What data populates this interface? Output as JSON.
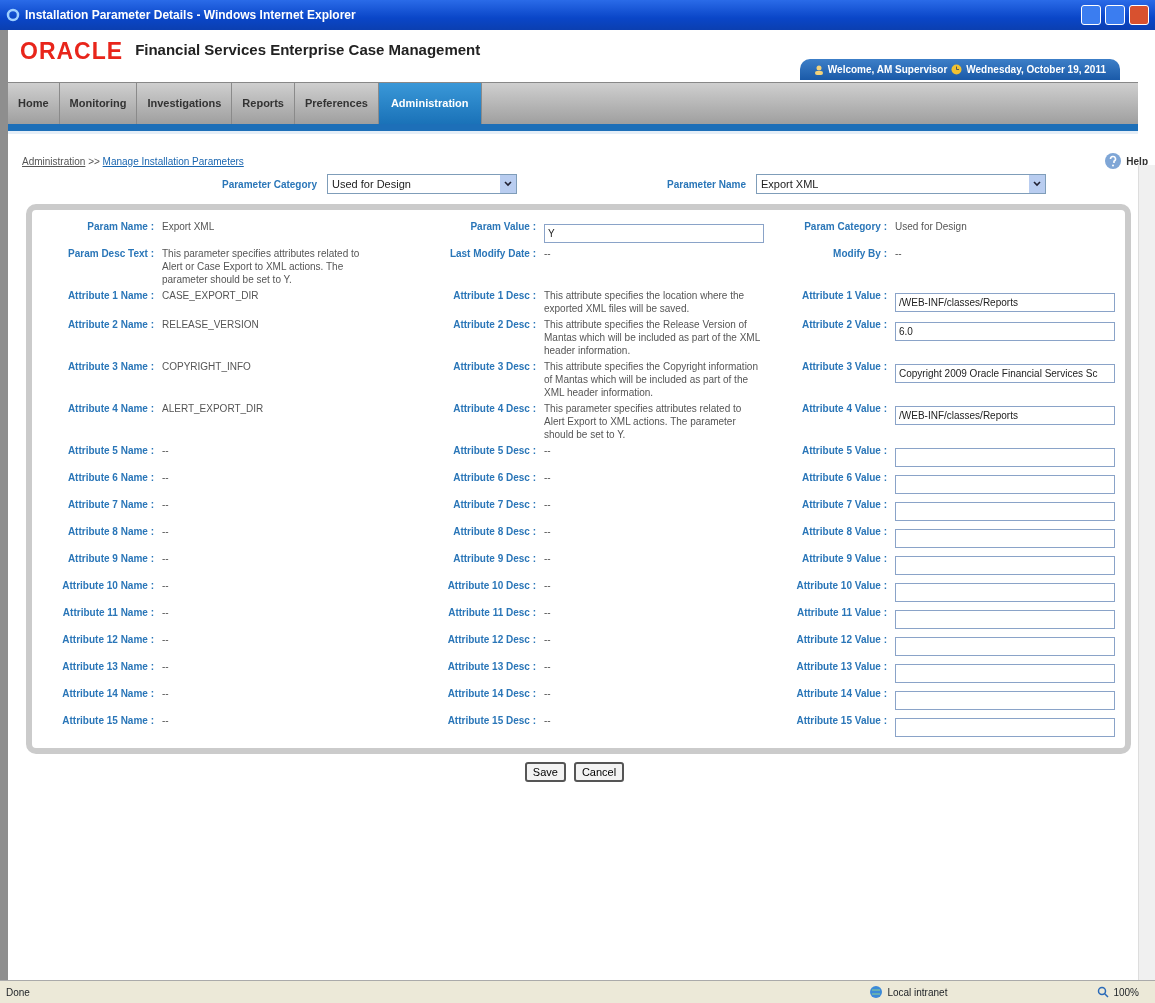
{
  "window": {
    "title": "Installation Parameter Details - Windows Internet Explorer"
  },
  "header": {
    "logo": "ORACLE",
    "app_title": "Financial Services Enterprise Case Management",
    "welcome": "Welcome, AM Supervisor",
    "date": "Wednesday, October 19, 2011"
  },
  "tabs": [
    {
      "label": "Home",
      "selected": false
    },
    {
      "label": "Monitoring",
      "selected": false
    },
    {
      "label": "Investigations",
      "selected": false
    },
    {
      "label": "Reports",
      "selected": false
    },
    {
      "label": "Preferences",
      "selected": false
    },
    {
      "label": "Administration",
      "selected": true
    }
  ],
  "breadcrumb": {
    "items": [
      "Administration",
      "Manage Installation Parameters"
    ],
    "separator": ">>"
  },
  "help": "Help",
  "filters": [
    {
      "label": "Parameter Category",
      "value": "Used for Design"
    },
    {
      "label": "Parameter Name",
      "value": "Export XML"
    }
  ],
  "rows": [
    [
      {
        "label": "Param Name :",
        "kind": "text",
        "value": "Export XML"
      },
      {
        "label": "Param Value :",
        "kind": "input",
        "value": "Y"
      },
      {
        "label": "Param Category :",
        "kind": "text",
        "value": "Used for Design"
      }
    ],
    [
      {
        "label": "Param Desc Text :",
        "kind": "text",
        "value": "This parameter specifies attributes related to Alert or Case Export to XML actions. The parameter should be set to Y."
      },
      {
        "label": "Last Modify Date :",
        "kind": "text",
        "value": "--"
      },
      {
        "label": "Modify By :",
        "kind": "text",
        "value": "--"
      }
    ],
    [
      {
        "label": "Attribute 1 Name :",
        "kind": "text",
        "value": "CASE_EXPORT_DIR"
      },
      {
        "label": "Attribute 1 Desc :",
        "kind": "text",
        "value": "This attribute specifies the location where the exported XML files will be saved."
      },
      {
        "label": "Attribute 1 Value :",
        "kind": "input",
        "value": "/WEB-INF/classes/Reports"
      }
    ],
    [
      {
        "label": "Attribute 2 Name :",
        "kind": "text",
        "value": "RELEASE_VERSION"
      },
      {
        "label": "Attribute 2 Desc :",
        "kind": "text",
        "value": "This attribute specifies the Release Version of Mantas which will be included as part of the XML header information."
      },
      {
        "label": "Attribute 2 Value :",
        "kind": "input",
        "value": "6.0"
      }
    ],
    [
      {
        "label": "Attribute 3 Name :",
        "kind": "text",
        "value": "COPYRIGHT_INFO"
      },
      {
        "label": "Attribute 3 Desc :",
        "kind": "text",
        "value": "This attribute specifies the Copyright information of Mantas which will be included as part of the XML header information."
      },
      {
        "label": "Attribute 3 Value :",
        "kind": "input",
        "value": "Copyright 2009 Oracle Financial Services Sc"
      }
    ],
    [
      {
        "label": "Attribute 4 Name :",
        "kind": "text",
        "value": "ALERT_EXPORT_DIR"
      },
      {
        "label": "Attribute 4 Desc :",
        "kind": "text",
        "value": "This parameter specifies attributes related to Alert Export to XML actions. The parameter should be set to Y."
      },
      {
        "label": "Attribute 4 Value :",
        "kind": "input",
        "value": "/WEB-INF/classes/Reports"
      }
    ],
    [
      {
        "label": "Attribute 5 Name :",
        "kind": "text",
        "value": "--"
      },
      {
        "label": "Attribute 5 Desc :",
        "kind": "text",
        "value": "--"
      },
      {
        "label": "Attribute 5 Value :",
        "kind": "input"
      }
    ],
    [
      {
        "label": "Attribute 6 Name :",
        "kind": "text",
        "value": "--"
      },
      {
        "label": "Attribute 6 Desc :",
        "kind": "text",
        "value": "--"
      },
      {
        "label": "Attribute 6 Value :",
        "kind": "input"
      }
    ],
    [
      {
        "label": "Attribute 7 Name :",
        "kind": "text",
        "value": "--"
      },
      {
        "label": "Attribute 7 Desc :",
        "kind": "text",
        "value": "--"
      },
      {
        "label": "Attribute 7 Value :",
        "kind": "input"
      }
    ],
    [
      {
        "label": "Attribute 8 Name :",
        "kind": "text",
        "value": "--"
      },
      {
        "label": "Attribute 8 Desc :",
        "kind": "text",
        "value": "--"
      },
      {
        "label": "Attribute 8 Value :",
        "kind": "input"
      }
    ],
    [
      {
        "label": "Attribute 9 Name :",
        "kind": "text",
        "value": "--"
      },
      {
        "label": "Attribute 9 Desc :",
        "kind": "text",
        "value": "--"
      },
      {
        "label": "Attribute 9 Value :",
        "kind": "input"
      }
    ],
    [
      {
        "label": "Attribute 10 Name :",
        "kind": "text",
        "value": "--"
      },
      {
        "label": "Attribute 10 Desc :",
        "kind": "text",
        "value": "--"
      },
      {
        "label": "Attribute 10 Value :",
        "kind": "input"
      }
    ],
    [
      {
        "label": "Attribute 11 Name :",
        "kind": "text",
        "value": "--"
      },
      {
        "label": "Attribute 11 Desc :",
        "kind": "text",
        "value": "--"
      },
      {
        "label": "Attribute 11 Value :",
        "kind": "input"
      }
    ],
    [
      {
        "label": "Attribute 12 Name :",
        "kind": "text",
        "value": "--"
      },
      {
        "label": "Attribute 12 Desc :",
        "kind": "text",
        "value": "--"
      },
      {
        "label": "Attribute 12 Value :",
        "kind": "input"
      }
    ],
    [
      {
        "label": "Attribute 13 Name :",
        "kind": "text",
        "value": "--"
      },
      {
        "label": "Attribute 13 Desc :",
        "kind": "text",
        "value": "--"
      },
      {
        "label": "Attribute 13 Value :",
        "kind": "input"
      }
    ],
    [
      {
        "label": "Attribute 14 Name :",
        "kind": "text",
        "value": "--"
      },
      {
        "label": "Attribute 14 Desc :",
        "kind": "text",
        "value": "--"
      },
      {
        "label": "Attribute 14 Value :",
        "kind": "input"
      }
    ],
    [
      {
        "label": "Attribute 15 Name :",
        "kind": "text",
        "value": "--"
      },
      {
        "label": "Attribute 15 Desc :",
        "kind": "text",
        "value": "--"
      },
      {
        "label": "Attribute 15 Value :",
        "kind": "input"
      }
    ]
  ],
  "buttons": [
    "Save",
    "Cancel"
  ],
  "status_bar": {
    "status": "Done",
    "zone": "Local intranet",
    "zoom": "100%"
  }
}
